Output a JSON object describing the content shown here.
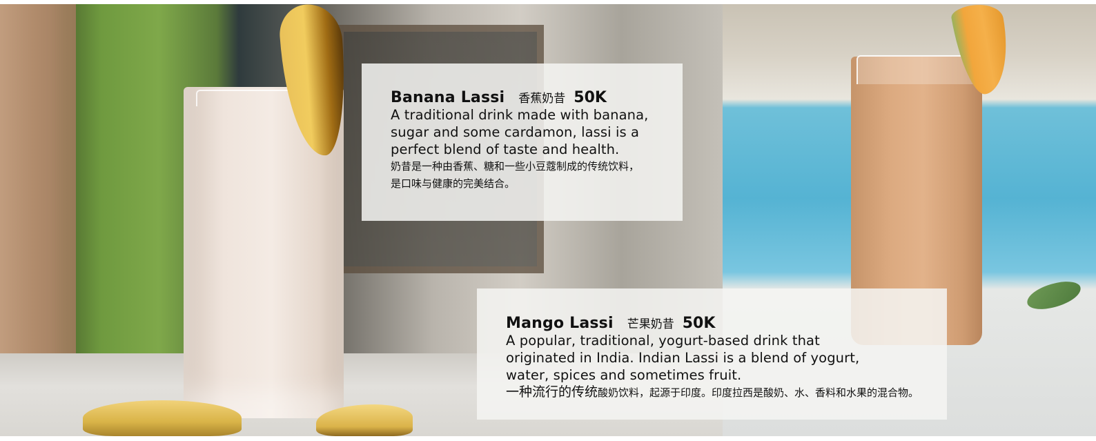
{
  "menu_items": [
    {
      "name": "Banana Lassi",
      "name_cn": "香蕉奶昔",
      "price": "50K",
      "description": "A traditional drink made with banana, sugar and some cardamon, lassi is a perfect blend of taste and health.",
      "description_cn_line1": "奶昔是一种由香蕉、糖和一些小豆蔻制成的传统饮料，",
      "description_cn_line2": "是口味与健康的完美结合。"
    },
    {
      "name": "Mango Lassi",
      "name_cn": "芒果奶昔",
      "price": "50K",
      "description": "A popular, traditional, yogurt-based drink that originated in India. Indian Lassi is a blend of yogurt, water, spices and sometimes fruit.",
      "description_cn_lead": "一种流行的传统",
      "description_cn_rest": "酸奶饮料，起源于印度。印度拉西是酸奶、水、香料和水果的混合物。"
    }
  ]
}
